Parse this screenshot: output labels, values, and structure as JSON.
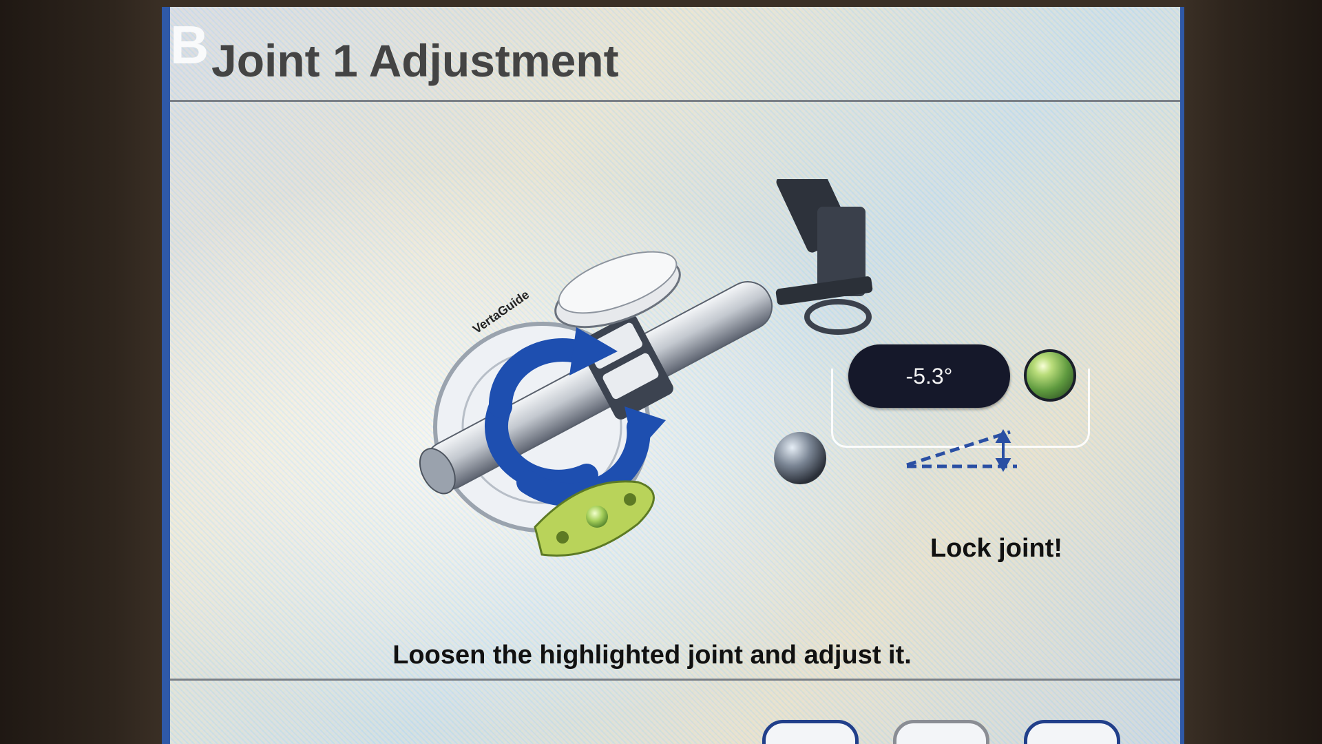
{
  "dialog": {
    "corner_letter": "B",
    "title": "Joint 1 Adjustment",
    "instruction": "Loosen the highlighted joint and adjust it."
  },
  "angle_readout": {
    "value": "-5.3°",
    "status": "green"
  },
  "lock_message": "Lock joint!",
  "device_illustration": {
    "brand_text": "VertaGuide"
  },
  "navigation": {
    "back_label": "",
    "cancel_label": "",
    "next_label": ""
  },
  "colors": {
    "frame_blue": "#2f59a8",
    "rotate_arrow_blue": "#1e4fb0",
    "indicator_green": "#5f9a3f",
    "pill_bg": "#15182a"
  }
}
